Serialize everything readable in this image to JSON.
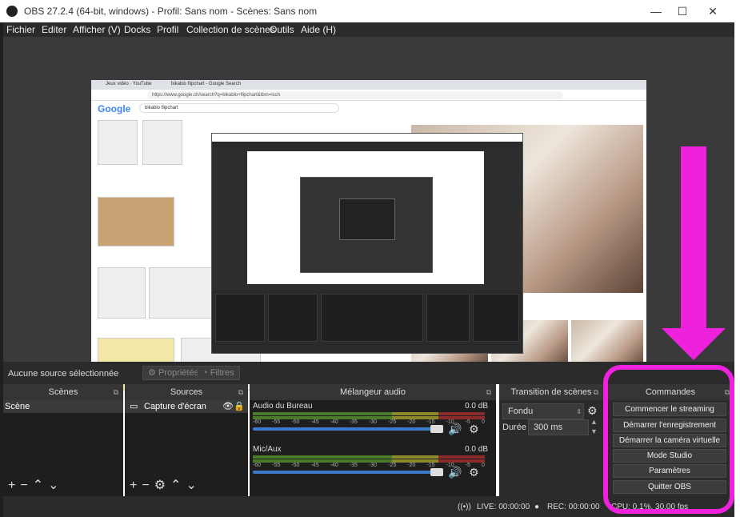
{
  "window": {
    "title": "OBS 27.2.4 (64-bit, windows) - Profil: Sans nom - Scènes: Sans nom",
    "minimize": "—",
    "maximize": "☐",
    "close": "✕"
  },
  "menu": [
    "Fichier",
    "Editer",
    "Afficher (V)",
    "Docks",
    "Profil",
    "Collection de scènes",
    "Outils",
    "Aide (H)"
  ],
  "preview": {
    "tab1": "Jeux vidéo · YouTube",
    "tab2": "bikablo flipchart - Google Search",
    "url": "https://www.google.ch/search?q=bikablo+flipchart&tbm=isch",
    "google_logo": "Google",
    "search_text": "bikablo flipchart"
  },
  "statusstrip": {
    "no_source": "Aucune source sélectionnée",
    "properties": "Propriétés",
    "filters": "Filtres"
  },
  "scenes": {
    "header": "Scènes",
    "items": [
      "Scène"
    ]
  },
  "sources": {
    "header": "Sources",
    "items": [
      "Capture d'écran"
    ]
  },
  "mixer": {
    "header": "Mélangeur audio",
    "tracks": [
      {
        "name": "Audio du Bureau",
        "db": "0.0 dB"
      },
      {
        "name": "Mic/Aux",
        "db": "0.0 dB"
      }
    ],
    "scale": [
      "-60",
      "-55",
      "-50",
      "-45",
      "-40",
      "-35",
      "-30",
      "-25",
      "-20",
      "-15",
      "-10",
      "-5",
      "0"
    ]
  },
  "transitions": {
    "header": "Transition de scènes",
    "type": "Fondu",
    "duration_label": "Durée",
    "duration_value": "300 ms"
  },
  "controls": {
    "header": "Commandes",
    "buttons": [
      "Commencer le streaming",
      "Démarrer l'enregistrement",
      "Démarrer la caméra virtuelle",
      "Mode Studio",
      "Paramètres",
      "Quitter OBS"
    ]
  },
  "status": {
    "live": "LIVE: 00:00:00",
    "rec": "REC: 00:00:00",
    "cpu": "CPU: 0.1%, 30.00 fps"
  },
  "colors": {
    "annotation": "#ee22dd",
    "dark_bg": "#2b2b2b",
    "accent_blue": "#3a7ac8"
  }
}
